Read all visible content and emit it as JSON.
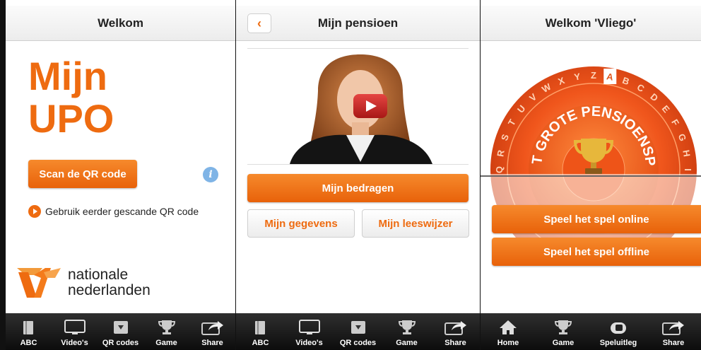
{
  "colors": {
    "accent": "#ee6b10",
    "info": "#7fb4e6",
    "tabbar": "#1a1a1a"
  },
  "screen1": {
    "title": "Welkom",
    "app_title_line1": "Mijn",
    "app_title_line2": "UPO",
    "scan_button": "Scan de QR code",
    "prev_qr_link": "Gebruik eerder gescande QR code",
    "logo_line1": "nationale",
    "logo_line2": "nederlanden",
    "tabs": [
      "ABC",
      "Video's",
      "QR codes",
      "Game",
      "Share"
    ]
  },
  "screen2": {
    "title": "Mijn pensioen",
    "back_icon": "chevron-left-icon",
    "primary_button": "Mijn bedragen",
    "button_gegevens": "Mijn gegevens",
    "button_leeswijzer": "Mijn leeswijzer",
    "tabs": [
      "ABC",
      "Video's",
      "QR codes",
      "Game",
      "Share"
    ]
  },
  "screen3": {
    "title": "Welkom 'Vliego'",
    "wheel_text": "HET GROTE PENSIOENSPEL",
    "wheel_letters": [
      "Q",
      "R",
      "S",
      "T",
      "U",
      "V",
      "W",
      "X",
      "Y",
      "Z",
      "A",
      "B",
      "C",
      "D",
      "E",
      "F",
      "G",
      "H",
      "I"
    ],
    "play_online": "Speel het spel online",
    "play_offline": "Speel het spel offline",
    "tabs": [
      "Home",
      "Game",
      "Speluitleg",
      "Share"
    ]
  }
}
